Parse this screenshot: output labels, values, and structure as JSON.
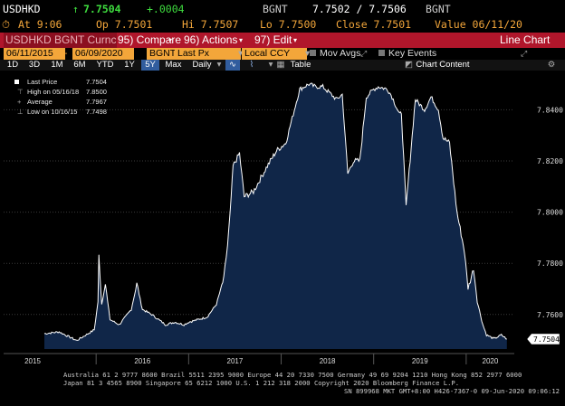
{
  "header": {
    "ticker": "USDHKD",
    "last_price": "7.7504",
    "change": "+.0004",
    "source": "BGNT",
    "bid_ask": "7.7502 / 7.7506",
    "source2": "BGNT",
    "at_time": "At 9:06",
    "open": "Op 7.7501",
    "high": "Hi 7.7507",
    "low": "Lo 7.7500",
    "close": "Close 7.7501",
    "value": "Value 06/11/20"
  },
  "toolbar": {
    "security": "USDHKD BGNT Curnc",
    "compare": "95) Compare",
    "actions": "96) Actions",
    "edit": "97) Edit",
    "view_title": "Line Chart"
  },
  "settings": {
    "start_date": "06/11/2015",
    "end_date": "06/09/2020",
    "source": "BGNT",
    "field": "Last Px",
    "currency": "Local CCY",
    "mov_avgs": "Mov Avgs",
    "key_events": "Key Events"
  },
  "periods": {
    "items": [
      "1D",
      "3D",
      "1M",
      "6M",
      "YTD",
      "1Y",
      "5Y",
      "Max"
    ],
    "selected": "5Y",
    "frequency": "Daily",
    "table": "Table",
    "chart_content": "Chart Content"
  },
  "legend": {
    "last_price_label": "Last Price",
    "last_price_value": "7.7504",
    "high_label": "High on 05/16/18",
    "high_value": "7.8500",
    "average_label": "Average",
    "average_value": "7.7967",
    "low_label": "Low on 10/16/15",
    "low_value": "7.7498"
  },
  "chart_data": {
    "type": "area",
    "title": "",
    "x_ticks": [
      "2015",
      "2016",
      "2017",
      "2018",
      "2019",
      "2020"
    ],
    "y_ticks": [
      "7.7600",
      "7.7800",
      "7.8000",
      "7.8200",
      "7.8400"
    ],
    "ylim": [
      7.7465,
      7.8525
    ],
    "last_value_label": "7.7504",
    "series": [
      {
        "fill_color": "#102648",
        "line_color": "#ffffff",
        "x": [
          2015.44,
          2015.6,
          2015.79,
          2015.98,
          2016.02,
          2016.03,
          2016.06,
          2016.1,
          2016.15,
          2016.25,
          2016.38,
          2016.44,
          2016.5,
          2016.6,
          2016.75,
          2016.85,
          2016.95,
          2017.0,
          2017.1,
          2017.2,
          2017.3,
          2017.38,
          2017.42,
          2017.45,
          2017.48,
          2017.55,
          2017.6,
          2017.7,
          2017.85,
          2017.95,
          2018.05,
          2018.2,
          2018.3,
          2018.37,
          2018.45,
          2018.6,
          2018.66,
          2018.72,
          2018.78,
          2018.85,
          2018.92,
          2019.0,
          2019.05,
          2019.15,
          2019.2,
          2019.28,
          2019.3,
          2019.35,
          2019.45,
          2019.55,
          2019.62,
          2019.7,
          2019.75,
          2019.82,
          2019.9,
          2019.98,
          2020.02,
          2020.08,
          2020.12,
          2020.18,
          2020.22,
          2020.3,
          2020.38,
          2020.44
        ],
        "values": [
          7.7525,
          7.7532,
          7.7498,
          7.754,
          7.765,
          7.783,
          7.764,
          7.772,
          7.758,
          7.756,
          7.762,
          7.772,
          7.762,
          7.76,
          7.756,
          7.757,
          7.756,
          7.757,
          7.758,
          7.759,
          7.764,
          7.774,
          7.787,
          7.8,
          7.818,
          7.823,
          7.806,
          7.808,
          7.818,
          7.824,
          7.827,
          7.848,
          7.85,
          7.849,
          7.849,
          7.844,
          7.846,
          7.815,
          7.82,
          7.82,
          7.845,
          7.848,
          7.849,
          7.848,
          7.845,
          7.838,
          7.839,
          7.802,
          7.844,
          7.84,
          7.845,
          7.84,
          7.829,
          7.827,
          7.8,
          7.785,
          7.77,
          7.778,
          7.765,
          7.756,
          7.752,
          7.7505,
          7.752,
          7.7504
        ]
      }
    ]
  },
  "footer": {
    "line1": "Australia 61 2 9777 8600 Brazil 5511 2395 9000 Europe 44 20 7330 7500 Germany 49 69 9204 1210 Hong Kong 852 2977 6000",
    "line2": "Japan 81 3 4565 8900        Singapore 65 6212 1000        U.S. 1 212 318 2000              Copyright 2020 Bloomberg Finance L.P.",
    "line3": "SN 899968 MKT  GMT+8:00 H426-7367-0 09-Jun-2020 09:06:12"
  },
  "colors": {
    "amber": "#f3a63a",
    "up_green": "#3fdd3f",
    "bar_red": "#b0162b",
    "area_fill": "#102648",
    "selected_blue": "#315d9e"
  }
}
